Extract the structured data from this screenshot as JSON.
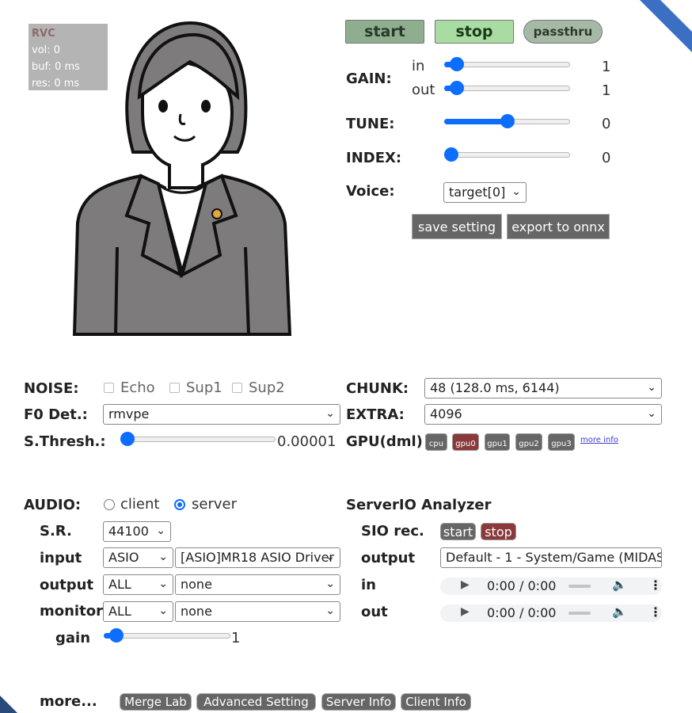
{
  "status": {
    "title": "RVC",
    "vol": "vol: 0",
    "buf": "buf: 0 ms",
    "res": "res: 0 ms"
  },
  "controls": {
    "start": "start",
    "stop": "stop",
    "passthru": "passthru",
    "gain_label": "GAIN:",
    "in_label": "in",
    "out_label": "out",
    "gain_in": "1",
    "gain_out": "1",
    "tune_label": "TUNE:",
    "tune_value": "0",
    "index_label": "INDEX:",
    "index_value": "0",
    "voice_label": "Voice:",
    "voice_value": "target[0]",
    "save_setting": "save setting",
    "export_onnx": "export to onnx"
  },
  "sliders": {
    "gain_in": 0.05,
    "gain_out": 0.05,
    "tune": 0.5,
    "index": 0.0,
    "threshold": 0.0,
    "monitor_gain": 0.05
  },
  "noise": {
    "label": "NOISE:",
    "echo": "Echo",
    "sup1": "Sup1",
    "sup2": "Sup2"
  },
  "f0": {
    "label": "F0 Det.:",
    "value": "rmvpe"
  },
  "thresh": {
    "label": "S.Thresh.:",
    "value": "0.00001"
  },
  "chunk": {
    "label": "CHUNK:",
    "value": "48 (128.0 ms, 6144)"
  },
  "extra": {
    "label": "EXTRA:",
    "value": "4096"
  },
  "gpu": {
    "label": "GPU(dml)",
    "cpu": "cpu",
    "gpu0": "gpu0",
    "gpu1": "gpu1",
    "gpu2": "gpu2",
    "gpu3": "gpu3",
    "more_info": "more info"
  },
  "audio": {
    "label": "AUDIO:",
    "client": "client",
    "server": "server",
    "sr_label": "S.R.",
    "sr_value": "44100",
    "input_label": "input",
    "input_type": "ASIO",
    "input_device": "[ASIO]MR18 ASIO Driver",
    "output_label": "output",
    "output_type": "ALL",
    "output_device": "none",
    "monitor_label": "monitor",
    "monitor_type": "ALL",
    "monitor_device": "none",
    "gain_label": "gain",
    "gain_value": "1"
  },
  "serverio": {
    "title": "ServerIO Analyzer",
    "rec_label": "SIO rec.",
    "start": "start",
    "stop": "stop",
    "output_label": "output",
    "output_value": "Default - 1 - System/Game (MIDAS",
    "in_label": "in",
    "in_time": "0:00 / 0:00",
    "out_label": "out",
    "out_time": "0:00 / 0:00"
  },
  "footer": {
    "more": "more...",
    "merge_lab": "Merge Lab",
    "advanced": "Advanced Setting",
    "server_info": "Server Info",
    "client_info": "Client Info"
  },
  "colors": {
    "accent": "#0d6efd",
    "start_bg": "#8fae8f",
    "stop_bg": "#a9dca2",
    "pass_bg": "#a6b8a6",
    "dark_btn": "#666666",
    "active_red": "#8a3a3a"
  }
}
